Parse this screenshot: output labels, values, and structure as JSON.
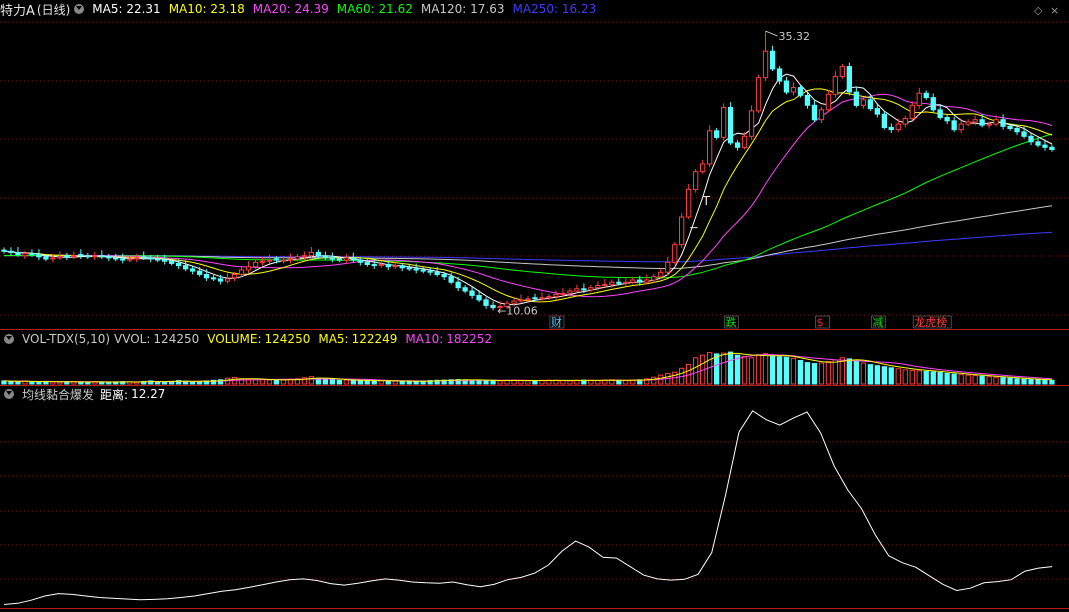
{
  "main_panel": {
    "stock_name": "特力A",
    "period": "(日线)",
    "ma": [
      {
        "label": "MA5:",
        "value": "22.31",
        "color": "#ffffff"
      },
      {
        "label": "MA10:",
        "value": "23.18",
        "color": "#ffff00"
      },
      {
        "label": "MA20:",
        "value": "24.39",
        "color": "#ff44ff"
      },
      {
        "label": "MA60:",
        "value": "21.62",
        "color": "#00ff00"
      },
      {
        "label": "MA120:",
        "value": "17.63",
        "color": "#c8c8c8"
      },
      {
        "label": "MA250:",
        "value": "16.23",
        "color": "#3c3cff"
      }
    ],
    "high_label": "35.32",
    "low_label": "10.06",
    "markers": [
      {
        "text": "财",
        "color": "#4fc8ff",
        "bar": 79
      },
      {
        "text": "跌",
        "color": "#00e000",
        "bar": 104
      },
      {
        "text": "$",
        "color": "#ff2020",
        "bar": 117
      },
      {
        "text": "减",
        "color": "#00e000",
        "bar": 125
      },
      {
        "text": "龙虎榜",
        "color": "#ff4040",
        "bar": 131
      }
    ],
    "t_marker": "T",
    "dash_marker": "−"
  },
  "volume_panel": {
    "indicator": "VOL-TDX(5,10)",
    "vvol_label": "VVOL:",
    "vvol": "124250",
    "volume_label": "VOLUME:",
    "volume": "124250",
    "ma5_label": "MA5:",
    "ma5": "122249",
    "ma10_label": "MA10:",
    "ma10": "182252"
  },
  "indicator_panel": {
    "name": "均线黏合爆发",
    "distance_label": "距离:",
    "distance": "12.27"
  },
  "colors": {
    "up": "#ff3c3c",
    "down": "#54ffff",
    "grid": "#7a1010",
    "separator": "#b41e1e"
  },
  "chart_data": {
    "type": "candlestick",
    "price_range": [
      10.06,
      35.32
    ],
    "volume_series_names": [
      "VOLUME",
      "MA5",
      "MA10"
    ],
    "ma_series_names": [
      "MA5",
      "MA10",
      "MA20",
      "MA60",
      "MA120",
      "MA250"
    ],
    "close": [
      15.4,
      15.3,
      15.1,
      15.2,
      15.1,
      14.9,
      14.7,
      14.8,
      14.9,
      14.9,
      15.0,
      15.0,
      14.9,
      15.0,
      14.9,
      14.8,
      14.7,
      14.6,
      14.7,
      14.8,
      14.8,
      14.7,
      14.6,
      14.5,
      14.3,
      14.1,
      13.8,
      13.6,
      13.3,
      13.0,
      12.9,
      12.7,
      12.9,
      13.3,
      13.7,
      14.0,
      14.4,
      14.5,
      14.6,
      14.6,
      14.6,
      14.7,
      14.9,
      15.0,
      15.3,
      15.0,
      14.8,
      14.7,
      14.6,
      14.8,
      14.6,
      14.4,
      14.2,
      14.1,
      14.2,
      14.0,
      14.1,
      13.9,
      13.8,
      13.7,
      13.6,
      13.5,
      13.3,
      13.1,
      12.6,
      12.1,
      11.8,
      11.4,
      11.0,
      10.5,
      10.3,
      10.4,
      10.7,
      10.9,
      11.0,
      11.1,
      11.1,
      11.2,
      11.3,
      11.5,
      11.6,
      11.8,
      12.0,
      11.9,
      12.1,
      12.3,
      12.4,
      12.6,
      12.5,
      12.6,
      12.8,
      12.6,
      12.8,
      13.1,
      13.5,
      14.4,
      16.0,
      18.5,
      21.0,
      22.6,
      23.3,
      26.3,
      25.7,
      28.4,
      25.2,
      24.8,
      25.8,
      28.1,
      31.1,
      33.5,
      31.9,
      30.8,
      29.8,
      30.2,
      29.5,
      28.6,
      27.3,
      28.2,
      29.6,
      31.2,
      32.1,
      29.8,
      28.6,
      29.1,
      28.3,
      27.8,
      26.6,
      26.4,
      26.9,
      27.4,
      28.6,
      29.7,
      29.3,
      28.2,
      27.5,
      27.2,
      26.4,
      26.9,
      27.1,
      27.3,
      26.8,
      26.9,
      27.3,
      26.7,
      26.5,
      26.2,
      25.8,
      25.3,
      25.0,
      24.8,
      24.6
    ],
    "open": [
      15.5,
      15.4,
      15.3,
      15.0,
      15.2,
      15.1,
      14.9,
      14.7,
      14.8,
      15.0,
      14.9,
      15.1,
      15.0,
      14.9,
      15.0,
      14.9,
      14.8,
      14.7,
      14.6,
      14.7,
      14.9,
      14.8,
      14.7,
      14.6,
      14.5,
      14.3,
      14.1,
      13.8,
      13.6,
      13.3,
      13.0,
      12.9,
      12.7,
      13.0,
      13.3,
      13.7,
      14.0,
      14.4,
      14.5,
      14.7,
      14.5,
      14.6,
      14.7,
      14.9,
      15.0,
      15.3,
      15.0,
      14.8,
      14.7,
      14.6,
      14.8,
      14.6,
      14.4,
      14.2,
      14.1,
      14.2,
      14.0,
      14.1,
      13.9,
      13.8,
      13.7,
      13.6,
      13.5,
      13.3,
      13.1,
      12.6,
      12.1,
      11.8,
      11.4,
      11.0,
      10.5,
      10.3,
      10.4,
      10.7,
      10.9,
      11.0,
      11.2,
      11.1,
      11.2,
      11.3,
      11.5,
      11.6,
      11.8,
      12.0,
      11.9,
      12.1,
      12.3,
      12.4,
      12.6,
      12.5,
      12.6,
      12.8,
      12.6,
      12.8,
      13.1,
      13.5,
      14.4,
      16.0,
      18.5,
      21.0,
      22.6,
      23.3,
      26.3,
      25.7,
      28.4,
      25.2,
      24.8,
      25.8,
      28.1,
      31.1,
      33.5,
      31.9,
      30.8,
      29.8,
      30.2,
      29.5,
      28.6,
      27.3,
      28.2,
      29.6,
      31.2,
      32.1,
      29.8,
      28.6,
      29.1,
      28.3,
      27.8,
      26.6,
      26.4,
      26.9,
      27.4,
      28.6,
      29.7,
      29.3,
      28.2,
      27.5,
      27.2,
      26.4,
      26.9,
      27.1,
      27.3,
      26.8,
      26.9,
      27.3,
      26.7,
      26.5,
      26.2,
      25.8,
      25.3,
      25.0,
      24.8
    ],
    "volume": [
      12,
      10,
      9,
      11,
      8,
      9,
      10,
      8,
      7,
      8,
      9,
      8,
      7,
      9,
      8,
      7,
      8,
      9,
      8,
      7,
      10,
      12,
      9,
      8,
      10,
      13,
      11,
      9,
      10,
      12,
      14,
      16,
      22,
      25,
      20,
      18,
      16,
      17,
      15,
      14,
      16,
      18,
      20,
      24,
      28,
      22,
      18,
      16,
      14,
      15,
      14,
      13,
      12,
      12,
      13,
      12,
      11,
      10,
      10,
      11,
      12,
      13,
      14,
      15,
      16,
      17,
      16,
      15,
      14,
      13,
      13,
      12,
      14,
      15,
      13,
      12,
      13,
      14,
      15,
      14,
      13,
      12,
      14,
      15,
      14,
      13,
      15,
      16,
      14,
      13,
      15,
      16,
      20,
      26,
      34,
      40,
      45,
      60,
      75,
      100,
      110,
      120,
      115,
      118,
      122,
      110,
      105,
      100,
      112,
      116,
      108,
      104,
      102,
      98,
      90,
      82,
      78,
      80,
      86,
      92,
      100,
      96,
      88,
      80,
      74,
      70,
      66,
      62,
      58,
      54,
      52,
      50,
      48,
      46,
      44,
      40,
      38,
      36,
      34,
      32,
      30,
      28,
      26,
      24,
      22,
      20,
      18,
      17,
      16,
      15,
      14
    ],
    "distance": [
      0.4,
      0.7,
      1.5,
      2.6,
      3.2,
      3.0,
      2.6,
      2.2,
      2.0,
      1.8,
      1.6,
      1.7,
      1.9,
      2.2,
      2.6,
      3.2,
      3.8,
      4.2,
      4.8,
      5.5,
      6.2,
      6.8,
      7.0,
      6.6,
      5.8,
      5.4,
      5.9,
      6.5,
      7.0,
      6.7,
      6.2,
      6.0,
      5.9,
      6.2,
      5.5,
      5.0,
      5.6,
      6.8,
      7.4,
      8.5,
      10.6,
      14.2,
      16.8,
      15.2,
      12.6,
      12.4,
      10.2,
      8.0,
      7.0,
      6.7,
      6.9,
      8.2,
      13.8,
      28.5,
      45.0,
      50.5,
      48.2,
      46.8,
      48.6,
      50.2,
      44.8,
      36.2,
      30.0,
      25.2,
      18.5,
      13.0,
      11.2,
      10.0,
      7.8,
      5.6,
      4.0,
      4.6,
      6.0,
      6.3,
      6.8,
      9.0,
      9.8,
      10.2
    ]
  }
}
